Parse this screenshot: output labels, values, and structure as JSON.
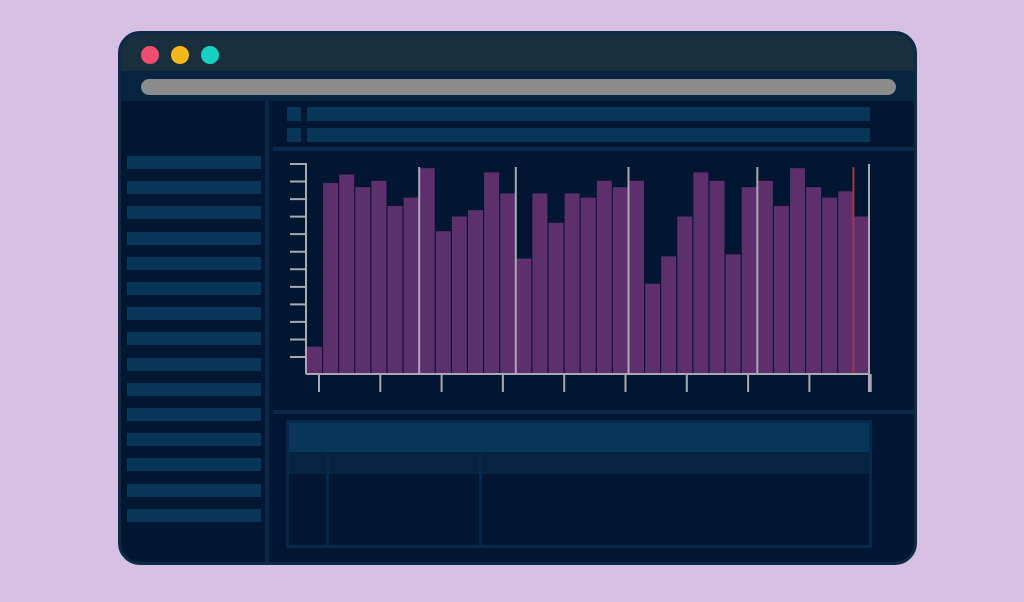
{
  "colors": {
    "background": "#d6c1e4",
    "window": "#011631",
    "titlebar": "#1a2f3e",
    "placeholder": "#073659",
    "bar_fill": "#5d2f6d",
    "axis": "#a9a9b4",
    "highlight_line": "#a0384a"
  },
  "window_controls": [
    {
      "name": "close-button",
      "color": "#ef4f6f"
    },
    {
      "name": "minimize-button",
      "color": "#f6b71b"
    },
    {
      "name": "maximize-button",
      "color": "#14d1c1"
    }
  ],
  "chart_data": {
    "type": "bar",
    "values": [
      13,
      91,
      95,
      89,
      92,
      80,
      84,
      98,
      68,
      75,
      78,
      96,
      86,
      55,
      86,
      72,
      86,
      84,
      92,
      89,
      92,
      43,
      56,
      75,
      96,
      92,
      57,
      89,
      92,
      80,
      98,
      89,
      84,
      87,
      75
    ],
    "ylim": [
      0,
      100
    ],
    "y_tick_count": 12,
    "x_tick_count": 10,
    "vertical_markers_at_bar": [
      7,
      13,
      20,
      28
    ],
    "highlight_marker_at_bar": 34,
    "grid": false,
    "legend": "none"
  }
}
